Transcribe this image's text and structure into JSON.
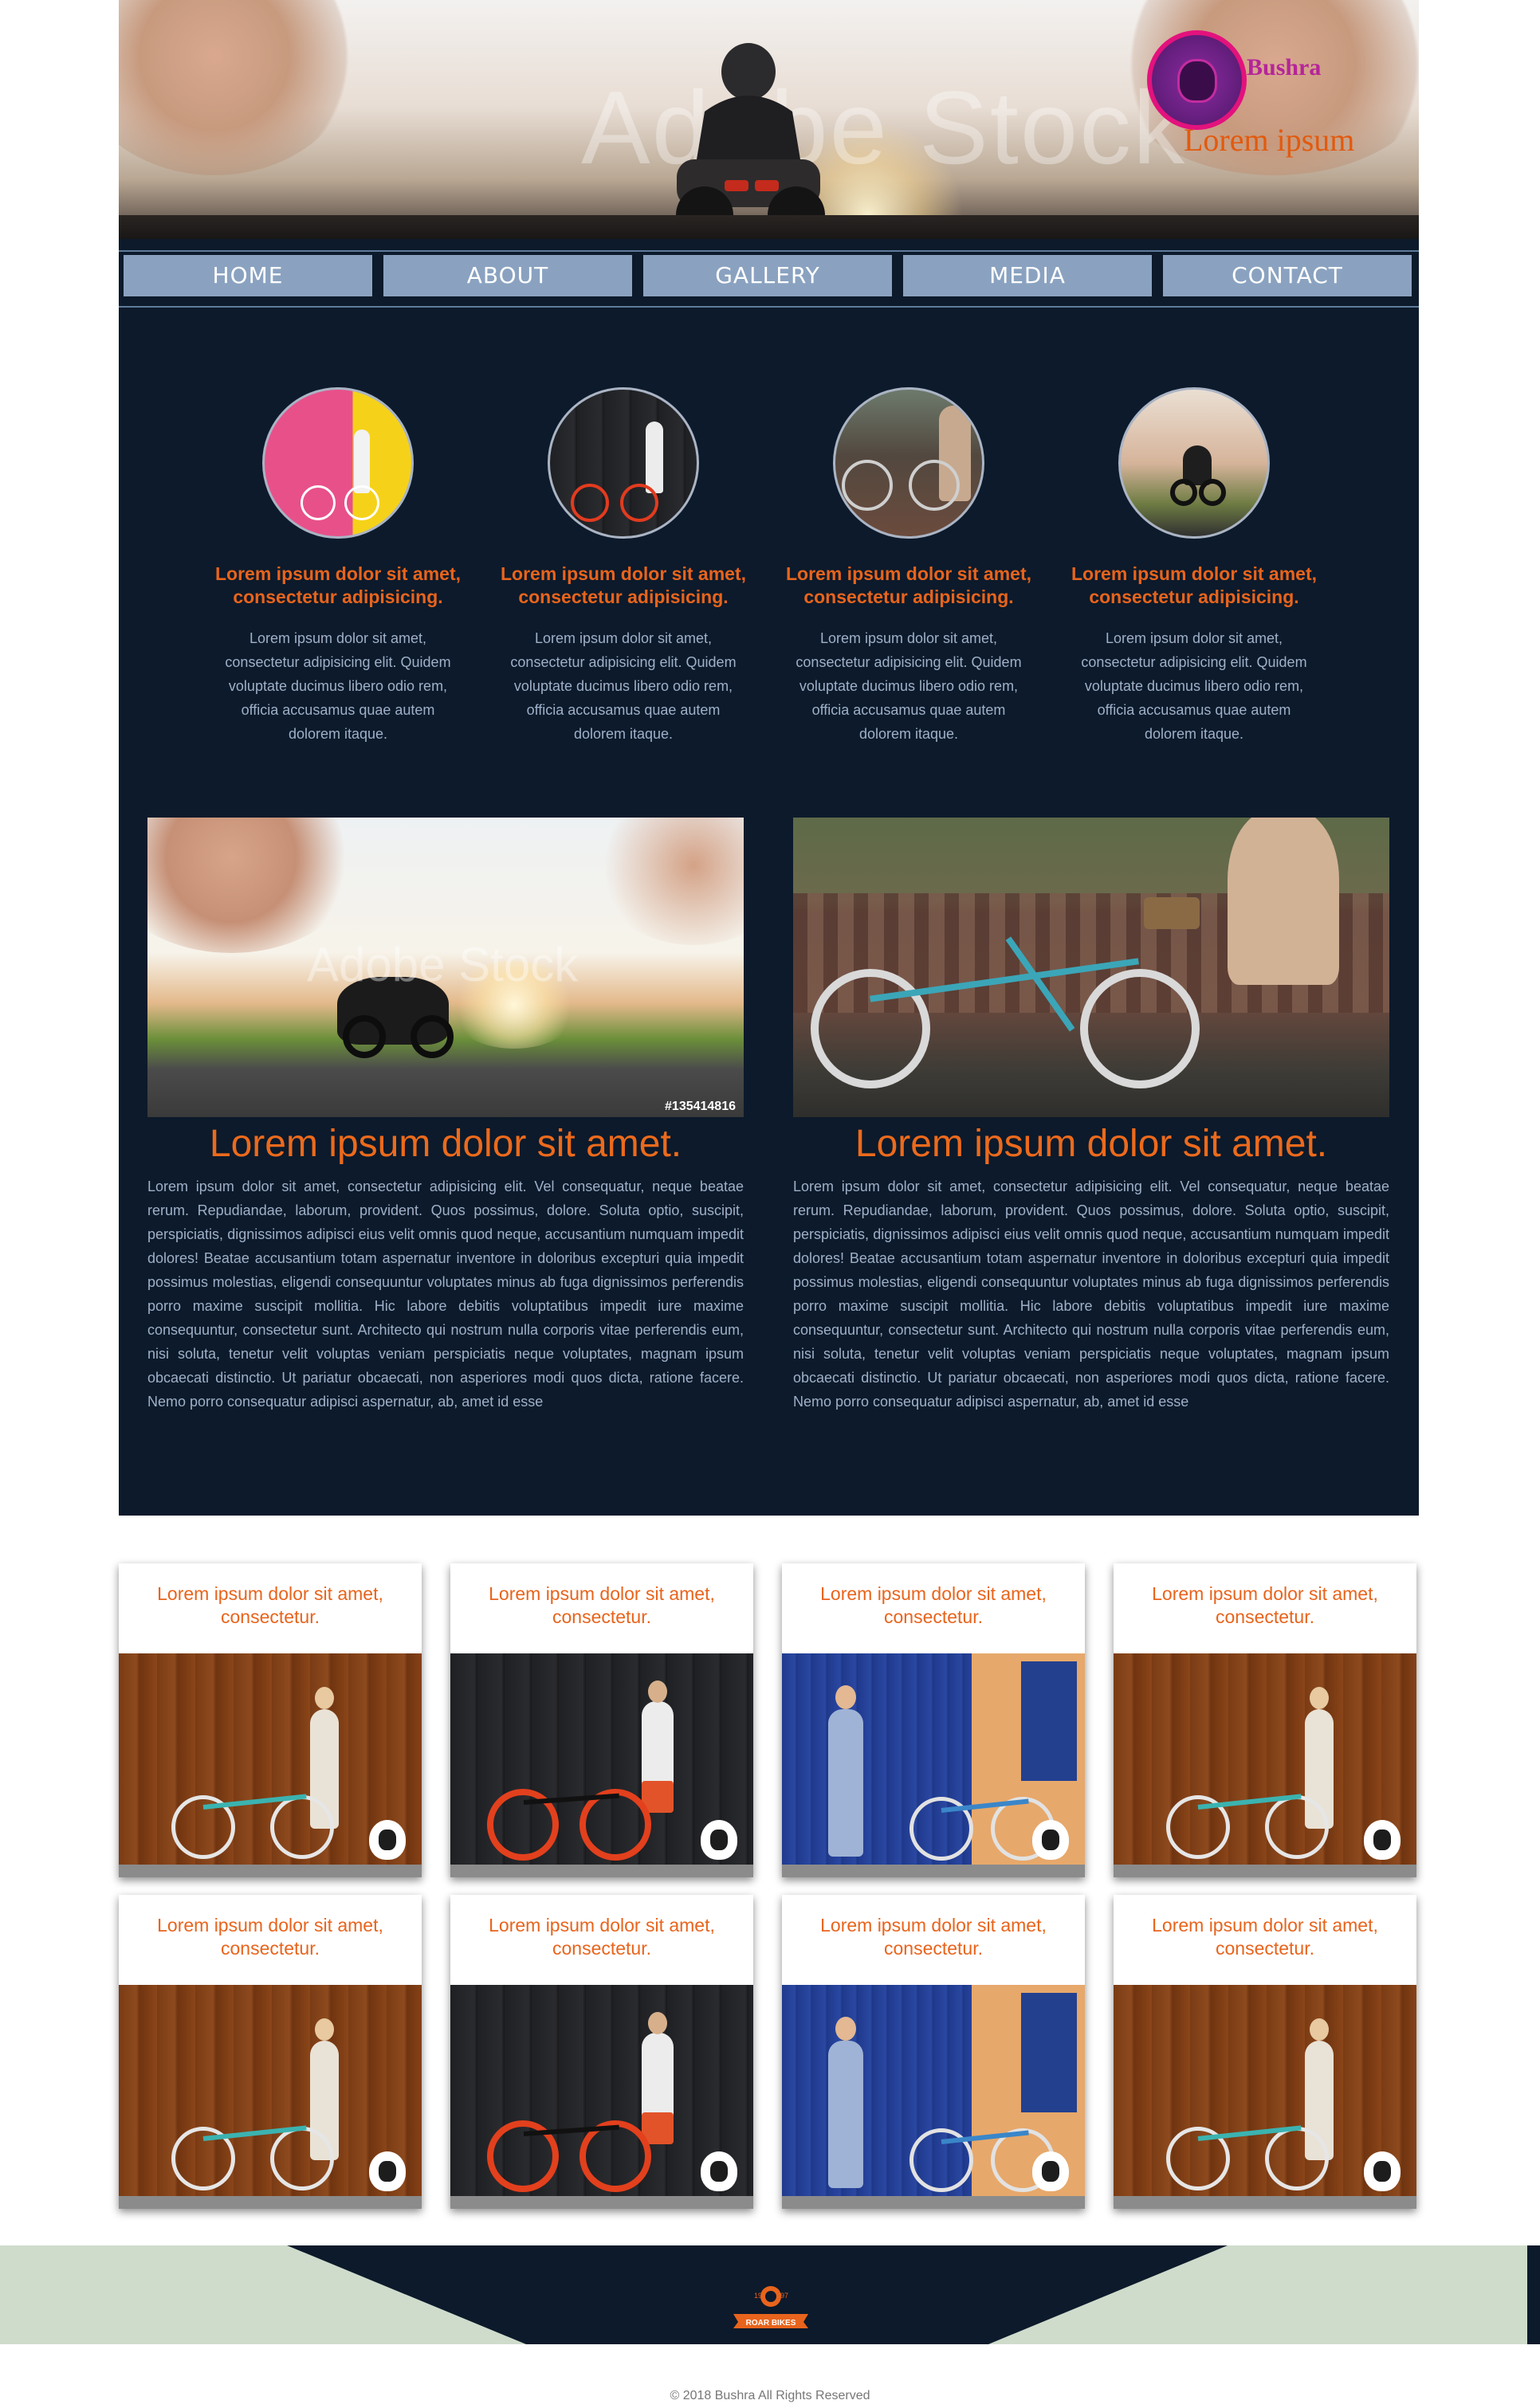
{
  "header": {
    "watermark": "Adobe Stock",
    "logo": {
      "name": "Bushra",
      "tagline": "Lorem ipsum"
    }
  },
  "nav": {
    "items": [
      {
        "label": "HOME"
      },
      {
        "label": "ABOUT"
      },
      {
        "label": "GALLERY"
      },
      {
        "label": "MEDIA"
      },
      {
        "label": "CONTACT"
      }
    ]
  },
  "features": [
    {
      "title": "Lorem ipsum dolor sit amet, consectetur adipisicing.",
      "text": "Lorem ipsum dolor sit amet, consectetur adipisicing elit. Quidem voluptate ducimus libero odio rem, officia accusamus quae autem dolorem itaque."
    },
    {
      "title": "Lorem ipsum dolor sit amet, consectetur adipisicing.",
      "text": "Lorem ipsum dolor sit amet, consectetur adipisicing elit. Quidem voluptate ducimus libero odio rem, officia accusamus quae autem dolorem itaque."
    },
    {
      "title": "Lorem ipsum dolor sit amet, consectetur adipisicing.",
      "text": "Lorem ipsum dolor sit amet, consectetur adipisicing elit. Quidem voluptate ducimus libero odio rem, officia accusamus quae autem dolorem itaque."
    },
    {
      "title": "Lorem ipsum dolor sit amet, consectetur adipisicing.",
      "text": "Lorem ipsum dolor sit amet, consectetur adipisicing elit. Quidem voluptate ducimus libero odio rem, officia accusamus quae autem dolorem itaque."
    }
  ],
  "articles": [
    {
      "photo_watermark": "Adobe Stock",
      "photo_id": "#135414816",
      "title": "Lorem ipsum dolor sit amet.",
      "body": "Lorem ipsum dolor sit amet, consectetur adipisicing elit. Vel consequatur, neque beatae rerum. Repudiandae, laborum, provident. Quos possimus, dolore. Soluta optio, suscipit, perspiciatis, dignissimos adipisci eius velit omnis quod neque, accusantium numquam impedit dolores! Beatae accusantium totam aspernatur inventore in doloribus excepturi quia impedit possimus molestias, eligendi consequuntur voluptates minus ab fuga dignissimos perferendis porro maxime suscipit mollitia. Hic labore debitis voluptatibus impedit iure maxime consequuntur, consectetur sunt. Architecto qui nostrum nulla corporis vitae perferendis eum, nisi soluta, tenetur velit voluptas veniam perspiciatis neque voluptates, magnam ipsum obcaecati distinctio. Ut pariatur obcaecati, non asperiores modi quos dicta, ratione facere. Nemo porro consequatur adipisci aspernatur, ab, amet id esse"
    },
    {
      "title": "Lorem ipsum dolor sit amet.",
      "body": "Lorem ipsum dolor sit amet, consectetur adipisicing elit. Vel consequatur, neque beatae rerum. Repudiandae, laborum, provident. Quos possimus, dolore. Soluta optio, suscipit, perspiciatis, dignissimos adipisci eius velit omnis quod neque, accusantium numquam impedit dolores! Beatae accusantium totam aspernatur inventore in doloribus excepturi quia impedit possimus molestias, eligendi consequuntur voluptates minus ab fuga dignissimos perferendis porro maxime suscipit mollitia. Hic labore debitis voluptatibus impedit iure maxime consequuntur, consectetur sunt. Architecto qui nostrum nulla corporis vitae perferendis eum, nisi soluta, tenetur velit voluptas veniam perspiciatis neque voluptates, magnam ipsum obcaecati distinctio. Ut pariatur obcaecati, non asperiores modi quos dicta, ratione facere. Nemo porro consequatur adipisci aspernatur, ab, amet id esse"
    }
  ],
  "cards": [
    {
      "title": "Lorem ipsum dolor sit amet, consectetur."
    },
    {
      "title": "Lorem ipsum dolor sit amet, consectetur."
    },
    {
      "title": "Lorem ipsum dolor sit amet, consectetur."
    },
    {
      "title": "Lorem ipsum dolor sit amet, consectetur."
    },
    {
      "title": "Lorem ipsum dolor sit amet, consectetur."
    },
    {
      "title": "Lorem ipsum dolor sit amet, consectetur."
    },
    {
      "title": "Lorem ipsum dolor sit amet, consectetur."
    },
    {
      "title": "Lorem ipsum dolor sit amet, consectetur."
    }
  ],
  "footer": {
    "emblem_text": "ROAR BIKES",
    "emblem_year_left": "19",
    "emblem_year_right": "97",
    "copyright": "© 2018 Bushra All Rights Reserved"
  },
  "colors": {
    "dark_bg": "#0c1a2b",
    "accent_orange": "#e8641c",
    "nav_button": "#8aa2c0",
    "footer_green": "#cfdccc",
    "logo_magenta": "#b5259a"
  }
}
